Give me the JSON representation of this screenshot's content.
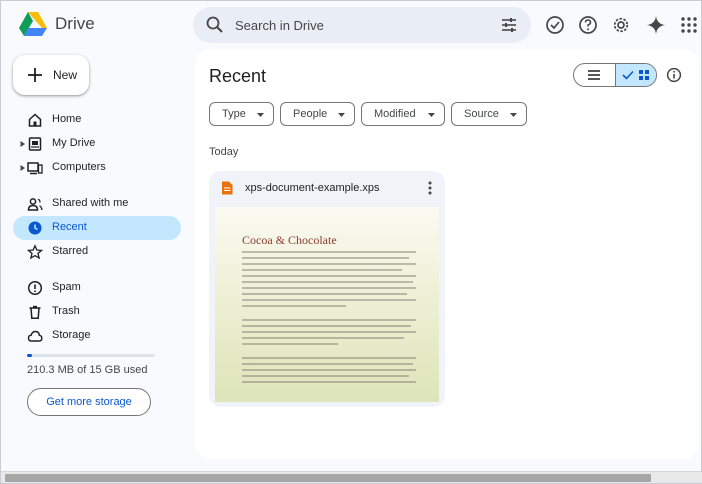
{
  "app": {
    "brand": "Drive"
  },
  "search": {
    "placeholder": "Search in Drive"
  },
  "topbar": {
    "icons": [
      "ready-for-offline-icon",
      "help-icon",
      "settings-icon",
      "gemini-icon",
      "apps-grid-icon"
    ]
  },
  "sidebar": {
    "new_label": "New",
    "items": [
      {
        "label": "Home",
        "icon": "home-icon",
        "active": false
      },
      {
        "label": "My Drive",
        "icon": "my-drive-icon",
        "expandable": true,
        "active": false
      },
      {
        "label": "Computers",
        "icon": "computers-icon",
        "expandable": true,
        "active": false
      },
      {
        "label": "Shared with me",
        "icon": "shared-icon",
        "active": false
      },
      {
        "label": "Recent",
        "icon": "clock-icon",
        "active": true
      },
      {
        "label": "Starred",
        "icon": "star-icon",
        "active": false
      },
      {
        "label": "Spam",
        "icon": "spam-icon",
        "active": false
      },
      {
        "label": "Trash",
        "icon": "trash-icon",
        "active": false
      },
      {
        "label": "Storage",
        "icon": "cloud-icon",
        "active": false
      }
    ],
    "storage_used_text": "210.3 MB of 15 GB used",
    "storage_used_fraction": 0.014,
    "storage_button": "Get more storage"
  },
  "main": {
    "title": "Recent",
    "view": {
      "list_label": "List layout",
      "grid_label": "Grid layout",
      "selected": "grid"
    },
    "filters": [
      "Type",
      "People",
      "Modified",
      "Source"
    ],
    "section_label": "Today",
    "files": [
      {
        "name": "xps-document-example.xps",
        "type_icon": "document-icon",
        "preview_title": "Cocoa & Chocolate"
      }
    ]
  },
  "colors": {
    "accent": "#0b57d0",
    "active_bg": "#c2e7ff",
    "app_bg": "#f8fafd",
    "search_bg": "#e9eef6",
    "card_bg": "#f0f4f9",
    "file_icon": "#e8710a"
  }
}
